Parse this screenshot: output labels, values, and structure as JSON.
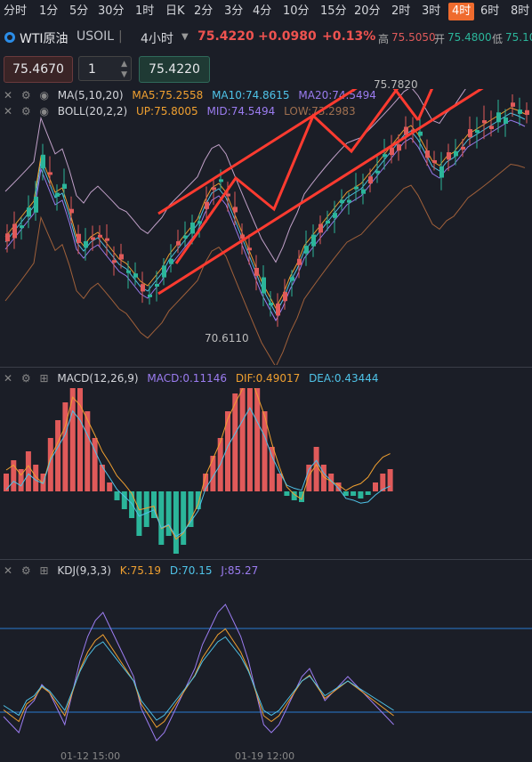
{
  "tabs": [
    "分时",
    "1分",
    "5分",
    "30分",
    "1时",
    "日K",
    "2分",
    "3分",
    "4分",
    "10分",
    "15分",
    "20分",
    "2时",
    "3时",
    "4时",
    "6时",
    "8时"
  ],
  "active_tab": "4时",
  "symbol": {
    "name": "WTI原油",
    "code": "USOIL",
    "period": "4小时",
    "price": "75.4220",
    "change": "+0.0980",
    "change_pct": "+0.13%",
    "high_label": "高",
    "high": "75.5050",
    "open_label": "开",
    "open": "75.4800",
    "low_label": "低",
    "low": "75.10"
  },
  "order": {
    "sell_price": "75.4670",
    "qty": "1",
    "buy_price": "75.4220"
  },
  "main_indicators": {
    "ma_label": "MA(5,10,20)",
    "ma5": "MA5:75.2558",
    "ma10": "MA10:74.8615",
    "ma20": "MA20:74.5494",
    "boll_label": "BOLL(20,2,2)",
    "up": "UP:75.8005",
    "mid": "MID:74.5494",
    "low": "LOW:73.2983"
  },
  "price_labels": {
    "high_mark": "75.7820",
    "low_mark": "70.6110"
  },
  "macd": {
    "label": "MACD(12,26,9)",
    "macd": "MACD:0.11146",
    "dif": "DIF:0.49017",
    "dea": "DEA:0.43444"
  },
  "kdj": {
    "label": "KDJ(9,3,3)",
    "k": "K:75.19",
    "d": "D:70.15",
    "j": "J:85.27"
  },
  "x_axis": [
    "01-12 15:00",
    "01-19 12:00"
  ],
  "colors": {
    "up": "#e05a5a",
    "down": "#2bb59a",
    "accent": "#ef6b2e",
    "ma5": "#f0a030",
    "ma10": "#4fc3e8",
    "ma20": "#9b7cf0",
    "arrow": "#ff3b30"
  }
}
